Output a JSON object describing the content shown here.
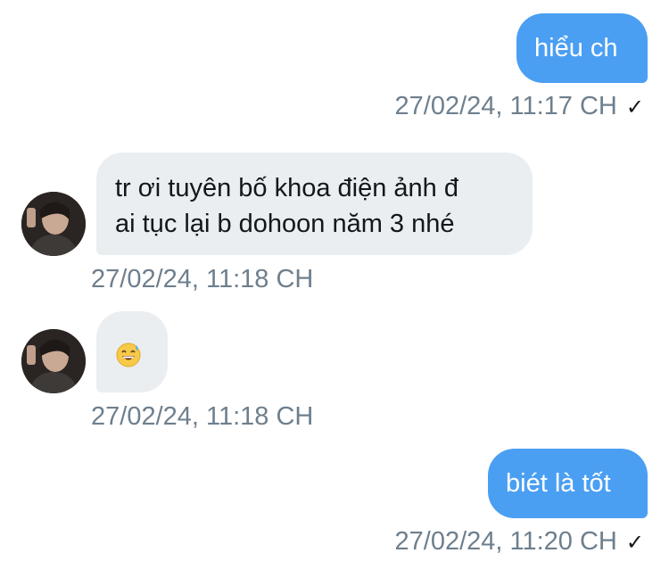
{
  "messages": [
    {
      "direction": "outgoing",
      "text": "hiểu ch",
      "time": "27/02/24, 11:17 CH",
      "read_mark": "✓"
    },
    {
      "direction": "incoming",
      "line1": "tr ơi tuyên bố khoa điện ảnh đ",
      "line2": "ai tục lại b dohoon năm 3 nhé",
      "time": "27/02/24, 11:18 CH",
      "avatar_icon": "user-avatar"
    },
    {
      "direction": "incoming",
      "emoji": "sweat-smile-emoji",
      "time": "27/02/24, 11:18 CH",
      "avatar_icon": "user-avatar"
    },
    {
      "direction": "outgoing",
      "text": "biét là tốt",
      "time": "27/02/24, 11:20 CH",
      "read_mark": "✓"
    }
  ],
  "colors": {
    "outgoing_bubble": "#4a9ff2",
    "incoming_bubble": "#eaeef1",
    "timestamp": "#6e7f8d"
  }
}
